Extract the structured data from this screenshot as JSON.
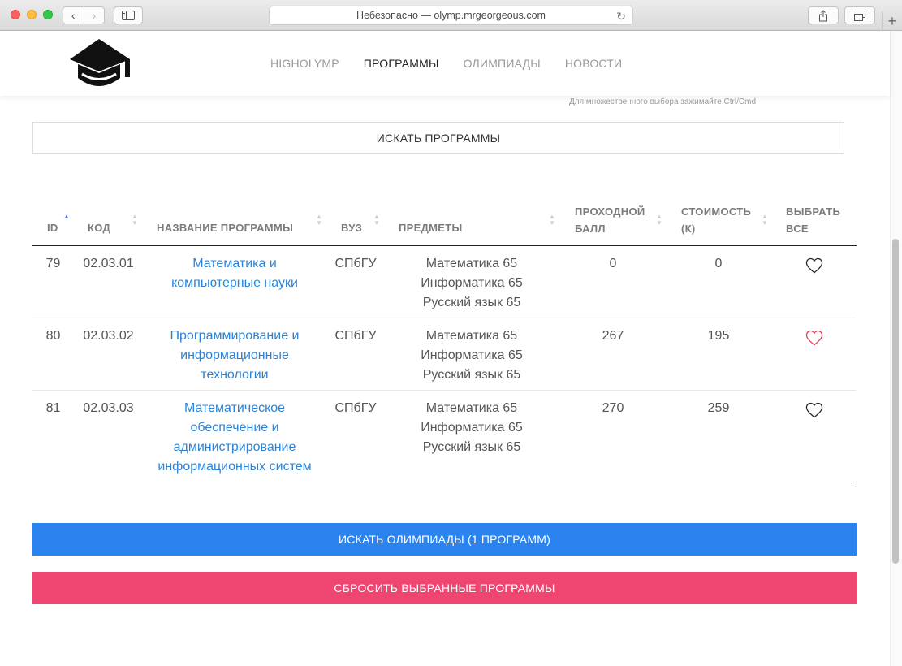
{
  "browser": {
    "address": "Небезопасно — olymp.mrgeorgeous.com",
    "back_icon": "‹",
    "forward_icon": "›",
    "reload_icon": "↻",
    "new_tab_icon": "+"
  },
  "header": {
    "menu": [
      {
        "label": "HIGHOLYMP",
        "active": false
      },
      {
        "label": "ПРОГРАММЫ",
        "active": true
      },
      {
        "label": "ОЛИМПИАДЫ",
        "active": false
      },
      {
        "label": "НОВОСТИ",
        "active": false
      }
    ]
  },
  "filter": {
    "hint": "Для множественного выбора зажимайте Ctrl/Cmd.",
    "search_button": "ИСКАТЬ ПРОГРАММЫ"
  },
  "table": {
    "columns": {
      "id": "ID",
      "code": "КОД",
      "name": "НАЗВАНИЕ ПРОГРАММЫ",
      "uni": "ВУЗ",
      "subjects": "ПРЕДМЕТЫ",
      "score_1": "ПРОХОДНОЙ",
      "score_2": "БАЛЛ",
      "cost_1": "СТОИМОСТЬ",
      "cost_2": "(К)",
      "select_1": "ВЫБРАТЬ",
      "select_2": "ВСЕ"
    },
    "rows": [
      {
        "id": "79",
        "code": "02.03.01",
        "name_lines": [
          "Математика и",
          "компьютерные науки"
        ],
        "uni": "СПбГУ",
        "subjects": [
          "Математика 65",
          "Информатика 65",
          "Русский язык 65"
        ],
        "score": "0",
        "cost": "0",
        "selected": false
      },
      {
        "id": "80",
        "code": "02.03.02",
        "name_lines": [
          "Программирование и",
          "информационные",
          "технологии"
        ],
        "uni": "СПбГУ",
        "subjects": [
          "Математика 65",
          "Информатика 65",
          "Русский язык 65"
        ],
        "score": "267",
        "cost": "195",
        "selected": true
      },
      {
        "id": "81",
        "code": "02.03.03",
        "name_lines": [
          "Математическое",
          "обеспечение и",
          "администрирование",
          "информационных систем"
        ],
        "uni": "СПбГУ",
        "subjects": [
          "Математика 65",
          "Информатика 65",
          "Русский язык 65"
        ],
        "score": "270",
        "cost": "259",
        "selected": false
      }
    ]
  },
  "actions": {
    "search_olympiads": "ИСКАТЬ ОЛИМПИАДЫ (1 ПРОГРАММ)",
    "reset_selection": "СБРОСИТЬ ВЫБРАННЫЕ ПРОГРАММЫ"
  },
  "colors": {
    "link": "#2a83d8",
    "primary_button": "#2a83ef",
    "reset_button": "#ee4571",
    "heart_selected": "#e8384f",
    "heart_default": "#222222"
  }
}
